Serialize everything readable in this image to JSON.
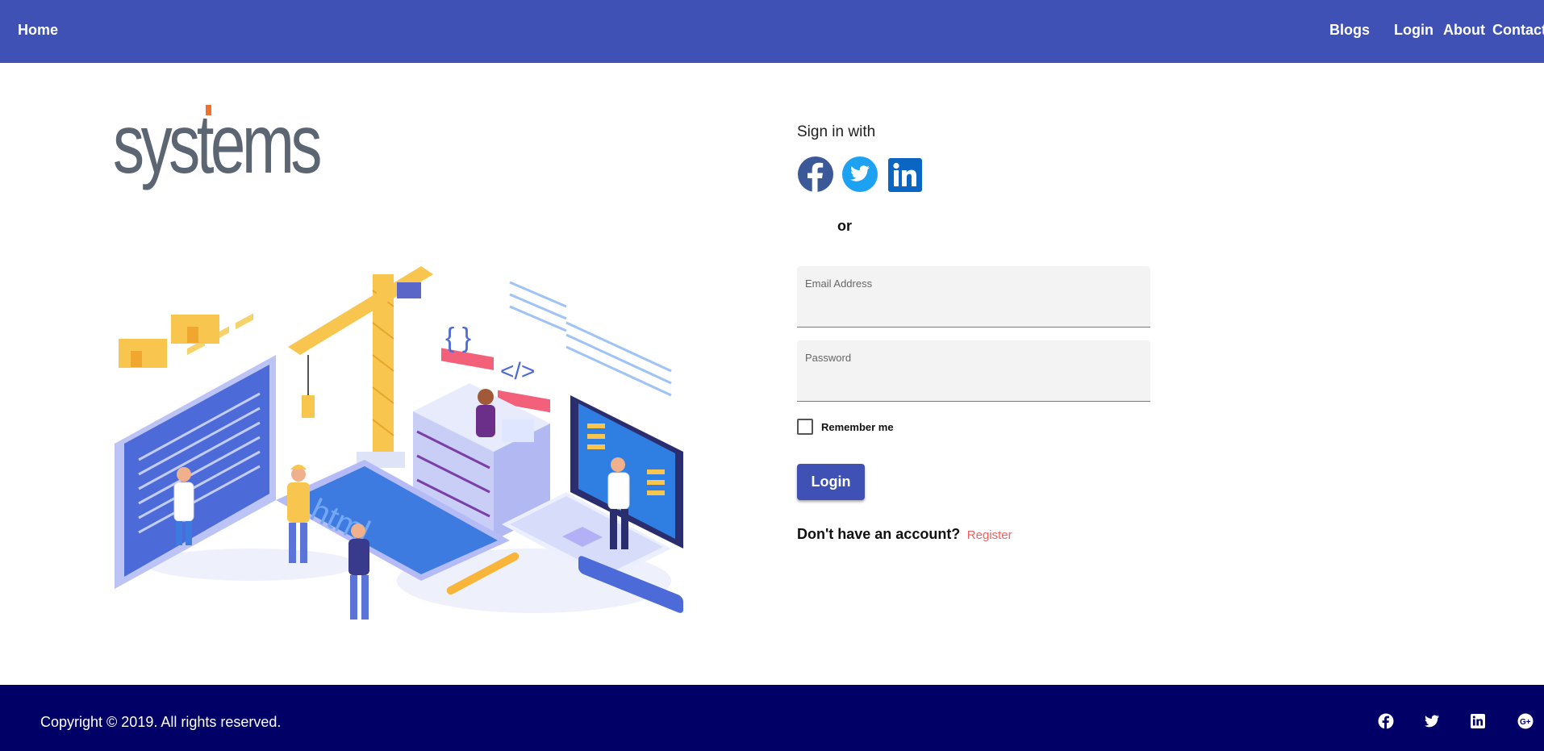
{
  "nav": {
    "home": "Home",
    "blogs": "Blogs",
    "login": "Login",
    "about": "About",
    "contact": "Contact"
  },
  "brand": {
    "logo_text": "systems"
  },
  "signin": {
    "title": "Sign in with",
    "social": [
      "facebook-icon",
      "twitter-icon",
      "linkedin-icon"
    ],
    "or": "or"
  },
  "form": {
    "email_label": "Email Address",
    "email_value": "",
    "password_label": "Password",
    "password_value": "",
    "remember_label": "Remember me",
    "remember_checked": false,
    "login_button": "Login",
    "no_account": "Don't have an account?",
    "register_link": "Register"
  },
  "footer": {
    "copyright": "Copyright © 2019. All rights reserved.",
    "icons": [
      "facebook-icon",
      "twitter-icon",
      "linkedin-icon",
      "google-plus-icon"
    ]
  },
  "colors": {
    "primary": "#3f51b5",
    "footer": "#000066",
    "link": "#f06060",
    "facebook": "#3b5998",
    "twitter": "#1da1f2",
    "linkedin": "#0a66c2"
  }
}
